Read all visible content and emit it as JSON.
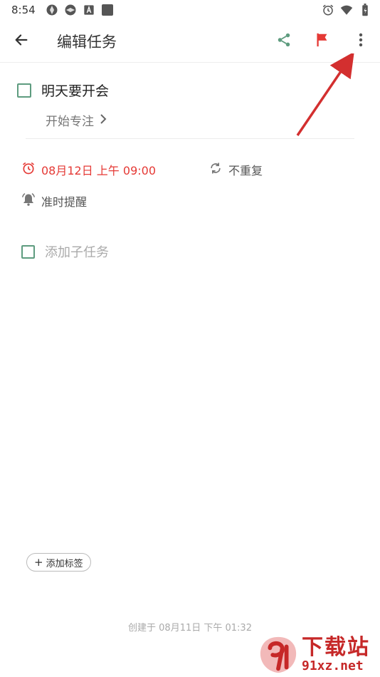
{
  "status_bar": {
    "time": "8:54",
    "icons_left": [
      "shutter-icon",
      "shutter-icon",
      "a-icon",
      "square-icon"
    ],
    "icons_right": [
      "alarm-icon",
      "wifi-icon",
      "battery-icon"
    ]
  },
  "app_bar": {
    "title": "编辑任务",
    "actions": [
      "share-icon",
      "flag-icon",
      "more-vert-icon"
    ]
  },
  "task": {
    "title": "明天要开会",
    "focus_label": "开始专注",
    "date_label": "08月12日 上午 09:00",
    "repeat_label": "不重复",
    "remind_label": "准时提醒",
    "subtask_placeholder": "添加子任务"
  },
  "tag_button": {
    "label": "添加标签"
  },
  "footer": {
    "created": "创建于 08月11日 下午 01:32"
  },
  "watermark": {
    "text": "下载站",
    "url": "91xz.net"
  },
  "colors": {
    "accent_green": "#5e9c7f",
    "date_red": "#e53935",
    "flag_red": "#e53935",
    "annotation_arrow": "#d32f2f"
  }
}
